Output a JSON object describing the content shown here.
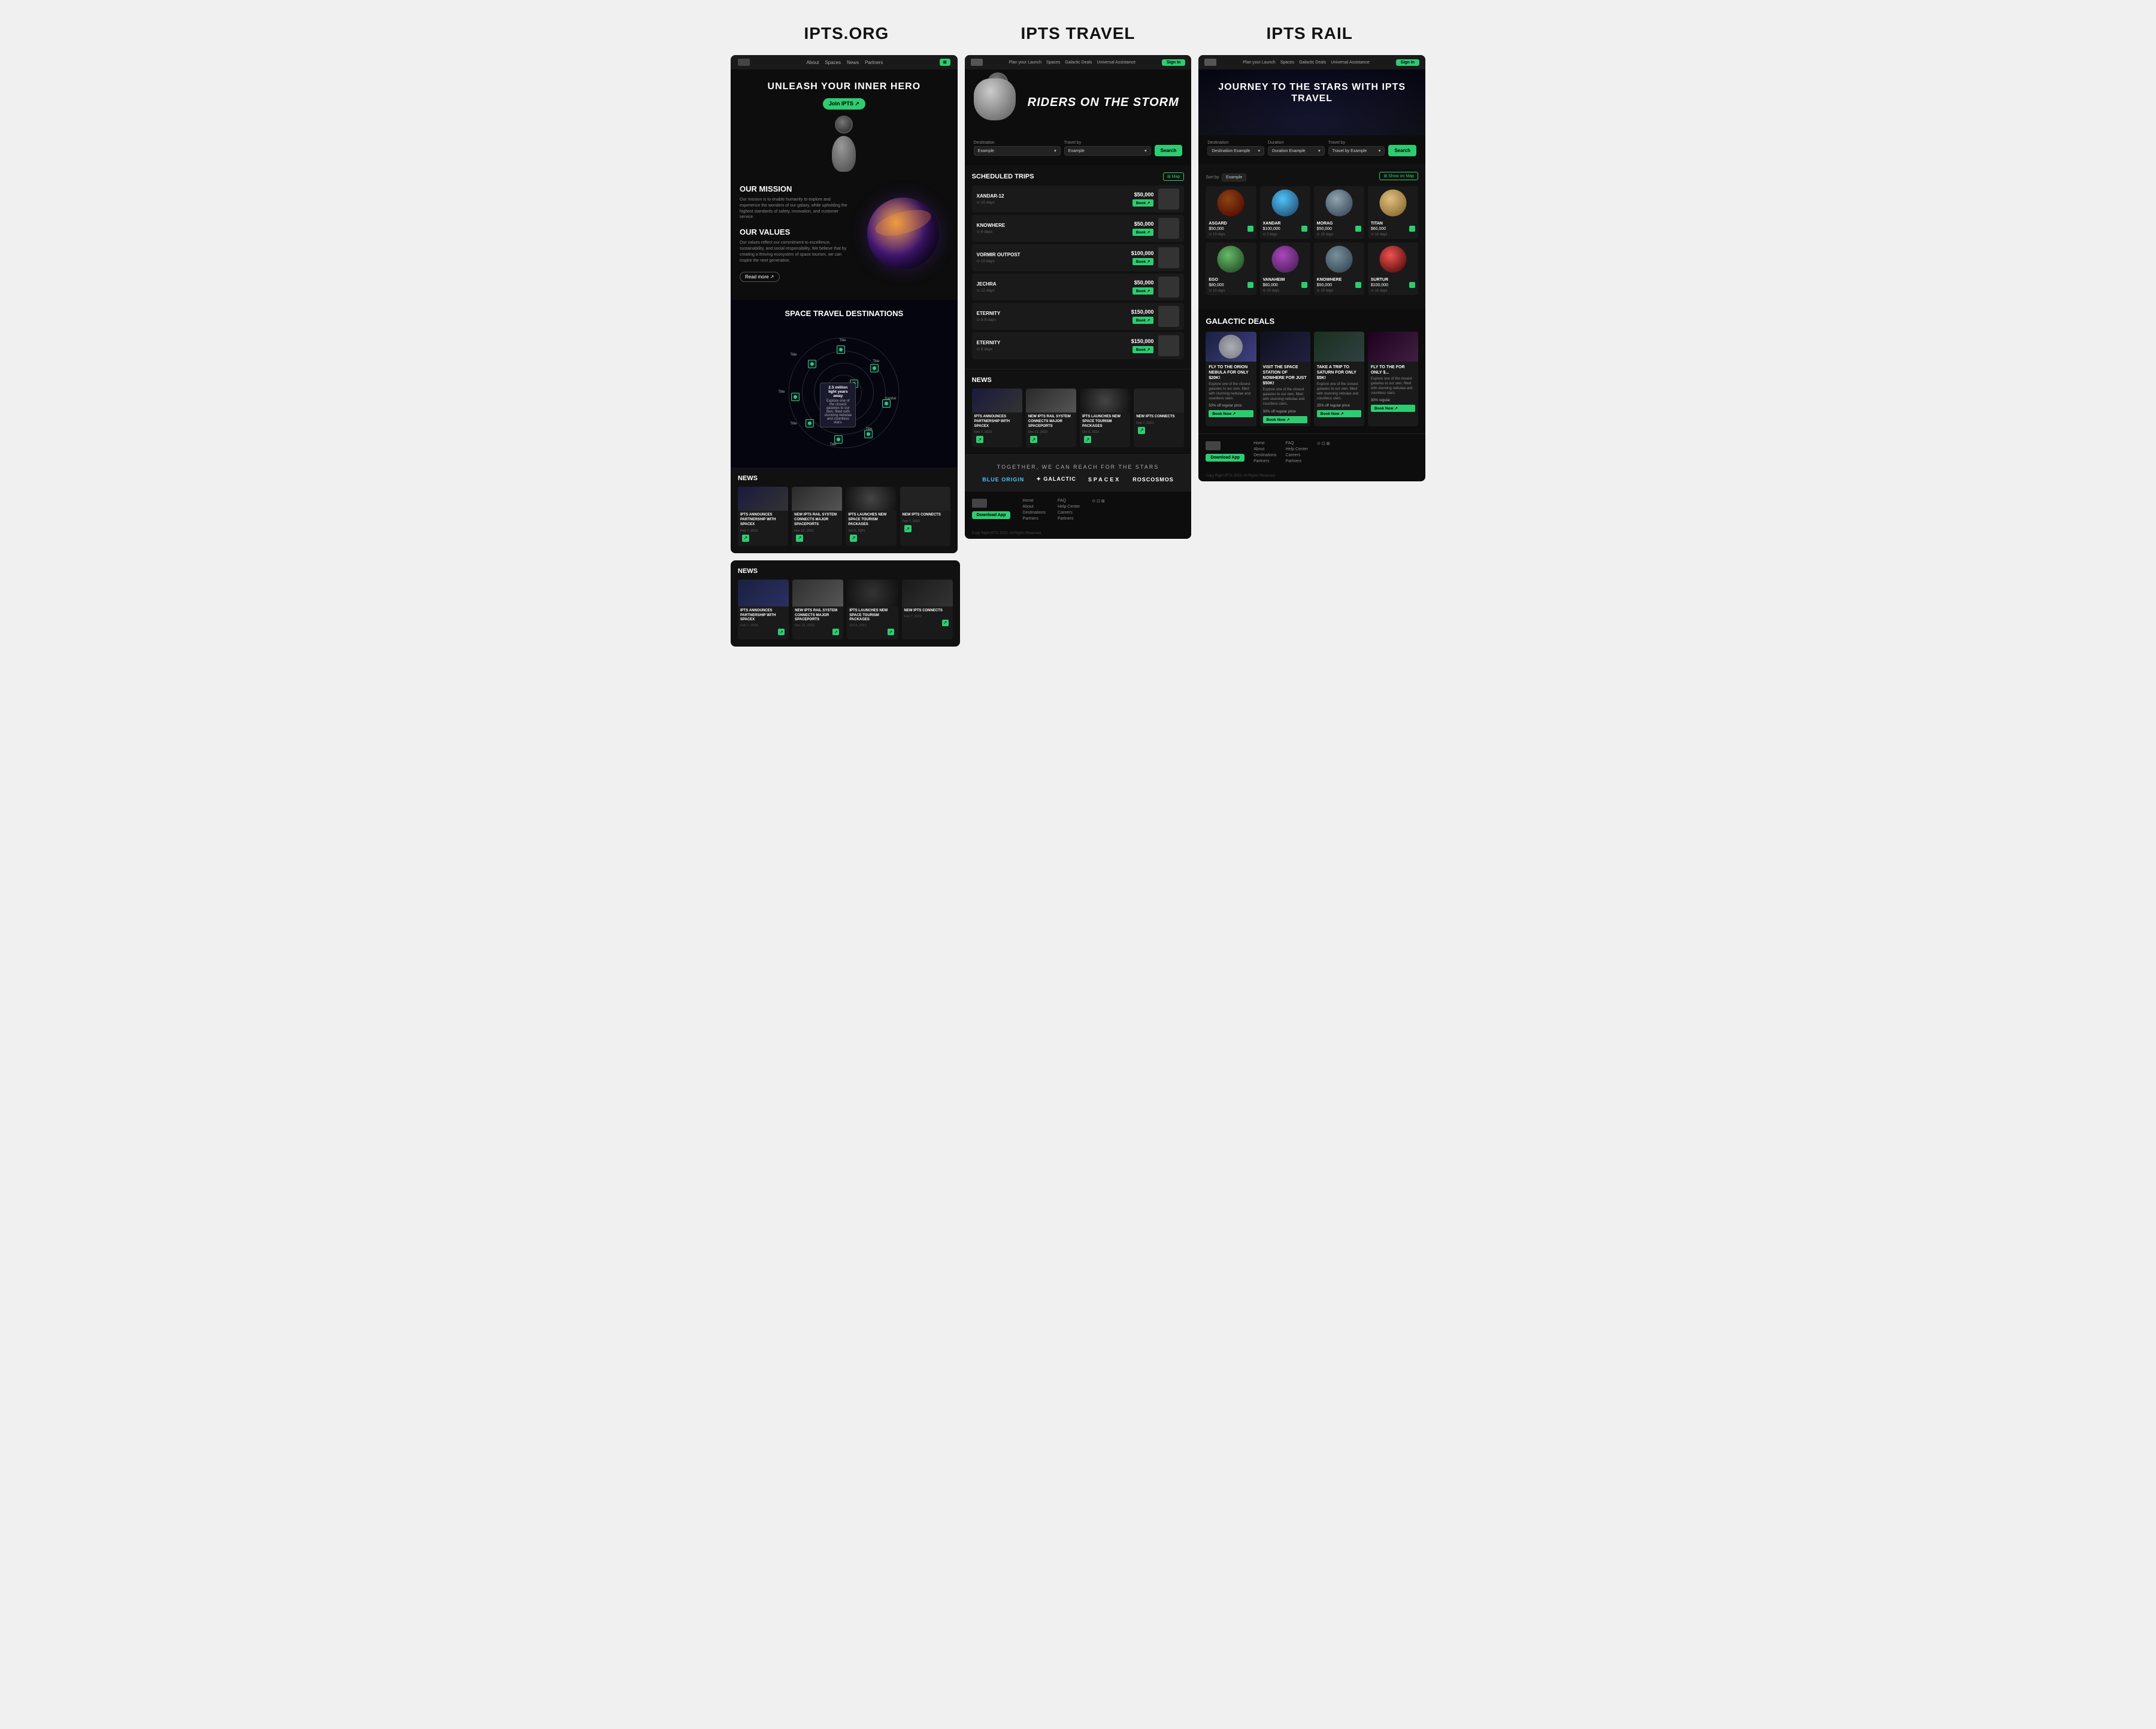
{
  "page": {
    "bg": "#f0f0f0"
  },
  "titles": {
    "col1": "IPTS.ORG",
    "col2": "IPTS TRAVEL",
    "col3": "IPTS RAIL"
  },
  "col1": {
    "nav": {
      "links": [
        "About",
        "Spaces",
        "News",
        "Partners"
      ]
    },
    "hero": {
      "title": "UNLEASH YOUR INNER HERO",
      "btn": "Join IPTS ↗"
    },
    "mission": {
      "title1": "OUR MISSION",
      "text1": "Our mission is to enable humanity to explore and experience the wonders of our galaxy, while upholding the highest standards of safety, innovation, and customer service.",
      "title2": "OUR VALUES",
      "text2": "Our values reflect our commitment to excellence, sustainability, and social responsibility. We believe that by creating a thriving ecosystem of space tourism, we can inspire the next generation.",
      "read_more": "Read more ↗"
    },
    "destinations": {
      "title": "SPACE TRAVEL DESTINATIONS"
    },
    "news": {
      "title": "NEWS",
      "items": [
        {
          "title": "IPTS ANNOUNCES PARTNERSHIP WITH SPACEX",
          "date": "Feb 7, 2023"
        },
        {
          "title": "NEW IPTS RAIL SYSTEM CONNECTS MAJOR SPACEPORTS",
          "date": "Dec 12, 2022"
        },
        {
          "title": "IPTS LAUNCHES NEW SPACE TOURISM PACKAGES",
          "date": "Oct 5, 2021"
        },
        {
          "title": "NEW IPTS CONNECTS",
          "date": "Feb 7, 2022"
        }
      ]
    }
  },
  "col2": {
    "nav": {
      "links": [
        "Plan your Launch",
        "Spaces",
        "Galactic Deals",
        "Universal Assistance"
      ],
      "btn": "Sign In"
    },
    "hero": {
      "title": "RIDERS ON THE STORM"
    },
    "search": {
      "destination_label": "Destination",
      "destination_placeholder": "Example",
      "travelby_label": "Travel by",
      "travelby_placeholder": "Example",
      "btn": "Search"
    },
    "trips": {
      "title": "SCHEDULED TRIPS",
      "map_btn": "⊞ Map",
      "items": [
        {
          "name": "XANDAR-12",
          "days": "⊙ 10 days",
          "price": "$50,000",
          "book": "Book ↗"
        },
        {
          "name": "KNOWHERE",
          "days": "⊙ 8 days",
          "price": "$50,000",
          "book": "Book ↗"
        },
        {
          "name": "VORMIR OUTPOST",
          "days": "⊙ 10 days",
          "price": "$100,000",
          "book": "Book ↗"
        },
        {
          "name": "JECHRA",
          "days": "⊙ 12 days",
          "price": "$50,000",
          "book": "Book ↗"
        },
        {
          "name": "ETERNITY",
          "days": "⊙ 8-9 days",
          "price": "$150,000",
          "book": "Book ↗"
        },
        {
          "name": "ETERNITY",
          "days": "⊙ 8 days",
          "price": "$150,000",
          "book": "Book ↗"
        }
      ]
    },
    "news": {
      "title": "NEWS",
      "items": [
        {
          "title": "IPTS ANNOUNCES PARTNERSHIP WITH SPACEX",
          "date": "Feb 7, 2023"
        },
        {
          "title": "NEW IPTS RAIL SYSTEM CONNECTS MAJOR SPACEPORTS",
          "date": "Dec 11, 2022"
        },
        {
          "title": "IPTS LAUNCHES NEW SPACE TOURISM PACKAGES",
          "date": "Oct 5, 2021"
        },
        {
          "title": "NEW IPTS CONNECTS",
          "date": "Feb 7, 2022"
        }
      ]
    },
    "footer_banner": {
      "text": "TOGETHER, WE CAN REACH FOR THE STARS",
      "partners": [
        "BLUE ORIGIN",
        "✦ GALACTIC",
        "SPACEX",
        "ROSCOSMOS"
      ]
    },
    "footer": {
      "download_btn": "Download App",
      "links1": [
        "Home",
        "About",
        "Destinations",
        "Partners"
      ],
      "links2": [
        "FAQ",
        "Help Center",
        "Careers",
        "Partners"
      ]
    },
    "copyright": "Copy Right IPTS 2023, All Rights Reserved"
  },
  "col3": {
    "nav": {
      "links": [
        "Plan your Launch",
        "Spaces",
        "Galactic Deals",
        "Universal Assistance"
      ],
      "btn": "Sign In"
    },
    "hero": {
      "title": "JOURNEY TO THE STARS\nWITH IPTS TRAVEL"
    },
    "search": {
      "destination_label": "Destination",
      "destination_placeholder": "Example",
      "duration_label": "Duration",
      "duration_placeholder": "Example",
      "travelby_label": "Travel by",
      "travelby_placeholder": "Example",
      "btn": "Search",
      "detected_destination": "Destination Example",
      "detected_duration": "Duration Example",
      "detected_travelby": "Travel by Example",
      "detected_search": "Search"
    },
    "planets": {
      "sort_label": "Sort by",
      "sort_value": "Example",
      "map_btn": "⊞ Show on Map",
      "items": [
        {
          "name": "ASGARD",
          "price": "$50,000",
          "days": "⊙ 10 days",
          "class": "p-asgard"
        },
        {
          "name": "XANDAR",
          "price": "$100,000",
          "days": "⊙ 3 days",
          "class": "p-xandar"
        },
        {
          "name": "MORAG",
          "price": "$50,000",
          "days": "⊙ 10 days",
          "class": "p-morag"
        },
        {
          "name": "TITAN",
          "price": "$60,000",
          "days": "⊙ 10 days",
          "class": "p-titan"
        },
        {
          "name": "EGO",
          "price": "$80,000",
          "days": "⊙ 10 days",
          "class": "p-ego"
        },
        {
          "name": "VANAHEIM",
          "price": "$60,000",
          "days": "⊙ 10 days",
          "class": "p-vanaheim"
        },
        {
          "name": "KNOWHERE",
          "price": "$50,000",
          "days": "⊙ 10 days",
          "class": "p-knowhere"
        },
        {
          "name": "SURTUR",
          "price": "$100,000",
          "days": "⊙ 10 days",
          "class": "p-surtur"
        }
      ]
    },
    "deals": {
      "title": "GALACTIC DEALS",
      "items": [
        {
          "title": "FLY TO THE ORION NEBULA FOR ONLY $20K!",
          "desc": "Explore one of the closest galaxies to our own, filled with stunning nebulae and countless stars.",
          "discount": "50% off regular price",
          "class": "deal-img"
        },
        {
          "title": "VISIT THE SPACE STATION OF NOWHERE FOR JUST $50K!",
          "desc": "Explore one of the closest galaxies to our own, filled with stunning nebulae and countless stars.",
          "discount": "30% off regular price",
          "class": "deal-img deal-img-2"
        },
        {
          "title": "TAKE A TRIP TO SATURN FOR ONLY $5K!",
          "desc": "Explore one of the closest galaxies to our own, filled with stunning nebulae and countless stars.",
          "discount": "25% off regular price",
          "class": "deal-img deal-img-3"
        },
        {
          "title": "FLY TO THE FOR ONLY $...",
          "desc": "Explore one of the closest galaxies to our own, filled with stunning nebulae and countless stars.",
          "discount": "30% regular",
          "class": "deal-img deal-img-4"
        }
      ]
    },
    "footer": {
      "download_btn": "Download App",
      "links1": [
        "Home",
        "About",
        "Destinations",
        "Partners"
      ],
      "links2": [
        "FAQ",
        "Help Center",
        "Careers",
        "Partners"
      ]
    },
    "copyright": "Copy Right IPTS 2023, All Rights Reserved"
  },
  "col2_detected": {
    "destination_example": "Destination Example",
    "search_btn": "Search"
  }
}
